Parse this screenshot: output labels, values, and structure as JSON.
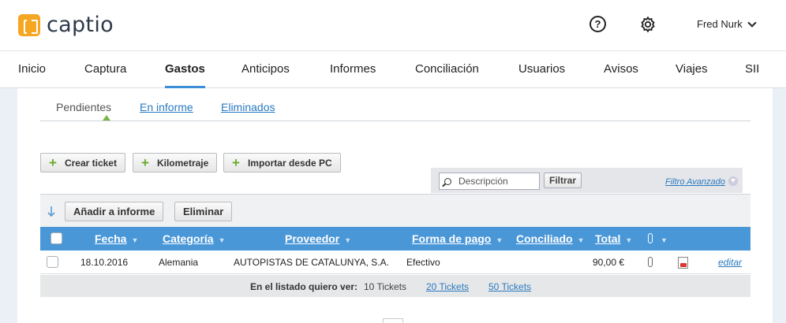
{
  "brand": {
    "name": "captio"
  },
  "header": {
    "user_name": "Fred Nurk"
  },
  "nav": {
    "items": [
      "Inicio",
      "Captura",
      "Gastos",
      "Anticipos",
      "Informes",
      "Conciliación",
      "Usuarios",
      "Avisos",
      "Viajes",
      "SII"
    ],
    "active": "Gastos"
  },
  "subtabs": {
    "pending": "Pendientes",
    "in_report": "En informe",
    "deleted": "Eliminados"
  },
  "toolbar": {
    "create_ticket": "Crear ticket",
    "mileage": "Kilometraje",
    "import_pc": "Importar desde PC"
  },
  "filter": {
    "search_placeholder": "Descripción",
    "filter_button": "Filtrar",
    "advanced_link": "Filtro Avanzado"
  },
  "actions": {
    "add_to_report": "Añadir a informe",
    "delete": "Eliminar"
  },
  "table": {
    "columns": [
      "Fecha",
      "Categoría",
      "Proveedor",
      "Forma de pago",
      "Conciliado",
      "Total"
    ],
    "rows": [
      {
        "date": "18.10.2016",
        "category": "Alemania",
        "provider": "AUTOPISTAS DE CATALUNYA, S.A.",
        "payment_method": "Efectivo",
        "reconciled": "",
        "total": "90,00 €",
        "edit": "editar"
      }
    ]
  },
  "pager": {
    "label": "En el listado quiero ver:",
    "current": "10 Tickets",
    "option_20": "20 Tickets",
    "option_50": "50 Tickets"
  },
  "colors": {
    "accent": "#4a97d8",
    "brand": "#f5a623",
    "plus": "#6aab2e",
    "tab_underline": "#3a8fd6"
  }
}
